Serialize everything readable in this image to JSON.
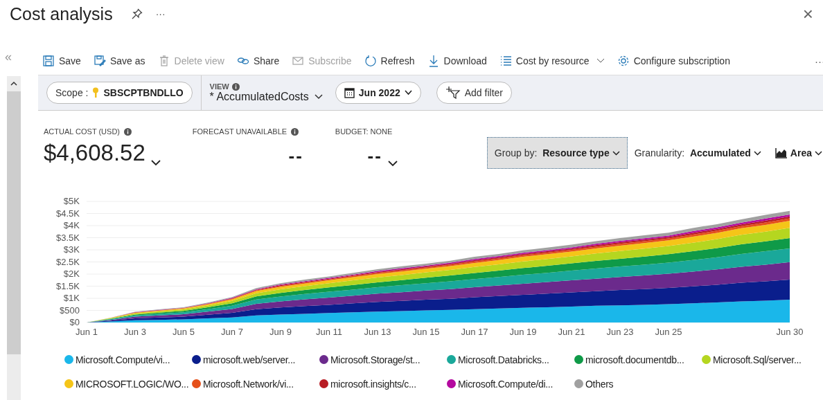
{
  "header": {
    "title": "Cost analysis",
    "more": "···",
    "close": "×"
  },
  "collapse": "«",
  "toolbar": [
    {
      "label": "Save",
      "disabled": false
    },
    {
      "label": "Save as",
      "disabled": false
    },
    {
      "label": "Delete view",
      "disabled": true
    },
    {
      "label": "Share",
      "disabled": false
    },
    {
      "label": "Subscribe",
      "disabled": true
    },
    {
      "label": "Refresh",
      "disabled": false
    },
    {
      "label": "Download",
      "disabled": false
    },
    {
      "label": "Cost by resource",
      "disabled": false
    },
    {
      "label": "Configure subscription",
      "disabled": false
    }
  ],
  "toolbar_more": "···",
  "filters": {
    "scope_label": "Scope :",
    "scope_value": "SBSCPTBNDLLO",
    "view_label": "VIEW",
    "view_value": "* AccumulatedCosts",
    "date": "Jun 2022",
    "add_filter": "Add filter"
  },
  "kpis": [
    {
      "label": "ACTUAL COST (USD)",
      "value": "$4,608.52",
      "info": true,
      "dropdown": true
    },
    {
      "label": "FORECAST UNAVAILABLE",
      "value": "--",
      "info": true,
      "dropdown": false
    },
    {
      "label": "BUDGET: NONE",
      "value": "--",
      "info": false,
      "dropdown": true
    }
  ],
  "controls": [
    {
      "label": "Group by:",
      "value": "Resource type",
      "selected": true
    },
    {
      "label": "Granularity:",
      "value": "Accumulated",
      "selected": false
    },
    {
      "value": "Area",
      "selected": false
    }
  ],
  "chart_data": {
    "type": "area",
    "stacked": true,
    "grid": true,
    "categories": [
      "Jun 1",
      null,
      "Jun 3",
      null,
      "Jun 5",
      null,
      "Jun 7",
      null,
      "Jun 9",
      null,
      "Jun 11",
      null,
      "Jun 13",
      null,
      "Jun 15",
      null,
      "Jun 17",
      null,
      "Jun 19",
      null,
      "Jun 21",
      null,
      "Jun 23",
      null,
      "Jun 25",
      null,
      null,
      null,
      null,
      "Jun 30"
    ],
    "ylim": [
      0,
      5000
    ],
    "yticks": [
      {
        "value": 0,
        "label": "$0"
      },
      {
        "value": 500,
        "label": "$500"
      },
      {
        "value": 1000,
        "label": "$1K"
      },
      {
        "value": 1500,
        "label": "$1.5K"
      },
      {
        "value": 2000,
        "label": "$2K"
      },
      {
        "value": 2500,
        "label": "$2.5K"
      },
      {
        "value": 3000,
        "label": "$3K"
      },
      {
        "value": 3500,
        "label": "$3.5K"
      },
      {
        "value": 4000,
        "label": "$4K"
      },
      {
        "value": 4500,
        "label": "$4.5K"
      },
      {
        "value": 5000,
        "label": "$5K"
      }
    ],
    "series": [
      {
        "name": "Microsoft.Compute/vi...",
        "color": "#1ab7ea",
        "values": [
          0,
          40,
          90,
          110,
          130,
          170,
          210,
          290,
          330,
          360,
          390,
          420,
          450,
          470,
          500,
          520,
          550,
          580,
          610,
          630,
          660,
          690,
          710,
          730,
          760,
          790,
          830,
          870,
          900,
          940
        ]
      },
      {
        "name": "microsoft.web/server...",
        "color": "#0a1e8c",
        "values": [
          0,
          40,
          80,
          100,
          110,
          150,
          190,
          260,
          290,
          320,
          340,
          370,
          400,
          420,
          440,
          460,
          490,
          510,
          530,
          560,
          580,
          600,
          630,
          650,
          670,
          700,
          730,
          770,
          800,
          830
        ]
      },
      {
        "name": "Microsoft.Storage/st...",
        "color": "#6b2a8c",
        "values": [
          0,
          30,
          70,
          80,
          100,
          130,
          160,
          220,
          250,
          280,
          300,
          320,
          340,
          360,
          380,
          400,
          420,
          440,
          460,
          480,
          500,
          520,
          540,
          560,
          580,
          610,
          630,
          660,
          690,
          720
        ]
      },
      {
        "name": "Microsoft.Databricks...",
        "color": "#1aa89a",
        "values": [
          0,
          30,
          50,
          70,
          80,
          100,
          130,
          180,
          200,
          220,
          240,
          250,
          270,
          290,
          300,
          320,
          330,
          350,
          370,
          380,
          400,
          420,
          430,
          450,
          460,
          480,
          500,
          530,
          550,
          570
        ]
      },
      {
        "name": "microsoft.documentdb...",
        "color": "#0f9a48",
        "values": [
          0,
          20,
          40,
          50,
          60,
          80,
          100,
          130,
          150,
          160,
          180,
          190,
          200,
          210,
          230,
          240,
          250,
          260,
          280,
          290,
          300,
          310,
          320,
          330,
          350,
          360,
          380,
          400,
          410,
          430
        ]
      },
      {
        "name": "Microsoft.Sql/server...",
        "color": "#b5d620",
        "values": [
          0,
          20,
          40,
          50,
          60,
          70,
          100,
          130,
          150,
          160,
          170,
          190,
          200,
          210,
          220,
          230,
          250,
          260,
          270,
          280,
          290,
          310,
          320,
          330,
          340,
          350,
          370,
          390,
          400,
          420
        ]
      },
      {
        "name": "MICROSOFT.LOGIC/WO...",
        "color": "#f5c518",
        "values": [
          0,
          10,
          30,
          30,
          40,
          50,
          70,
          90,
          100,
          110,
          120,
          130,
          140,
          150,
          150,
          160,
          170,
          180,
          190,
          200,
          200,
          210,
          220,
          230,
          230,
          250,
          260,
          270,
          280,
          290
        ]
      },
      {
        "name": "Microsoft.Network/vi...",
        "color": "#e5501a",
        "values": [
          0,
          0,
          10,
          10,
          10,
          20,
          20,
          30,
          40,
          40,
          40,
          50,
          50,
          50,
          50,
          60,
          60,
          60,
          70,
          70,
          70,
          70,
          80,
          80,
          80,
          90,
          90,
          90,
          100,
          100
        ]
      },
      {
        "name": "microsoft.insights/c...",
        "color": "#b81c24",
        "values": [
          0,
          0,
          10,
          10,
          10,
          10,
          20,
          20,
          30,
          30,
          30,
          30,
          40,
          40,
          40,
          40,
          50,
          50,
          50,
          50,
          50,
          60,
          60,
          60,
          60,
          70,
          70,
          70,
          80,
          80
        ]
      },
      {
        "name": "Microsoft.Compute/di...",
        "color": "#b4099f",
        "values": [
          0,
          0,
          10,
          10,
          10,
          10,
          20,
          20,
          30,
          30,
          30,
          30,
          40,
          40,
          40,
          40,
          50,
          50,
          50,
          50,
          50,
          60,
          60,
          60,
          60,
          70,
          70,
          70,
          80,
          80
        ]
      },
      {
        "name": "Others",
        "color": "#a0a0a0",
        "values": [
          0,
          10,
          10,
          20,
          20,
          30,
          30,
          50,
          50,
          60,
          60,
          70,
          70,
          80,
          80,
          80,
          90,
          90,
          100,
          100,
          110,
          110,
          120,
          120,
          120,
          130,
          130,
          140,
          150,
          150
        ]
      }
    ]
  }
}
